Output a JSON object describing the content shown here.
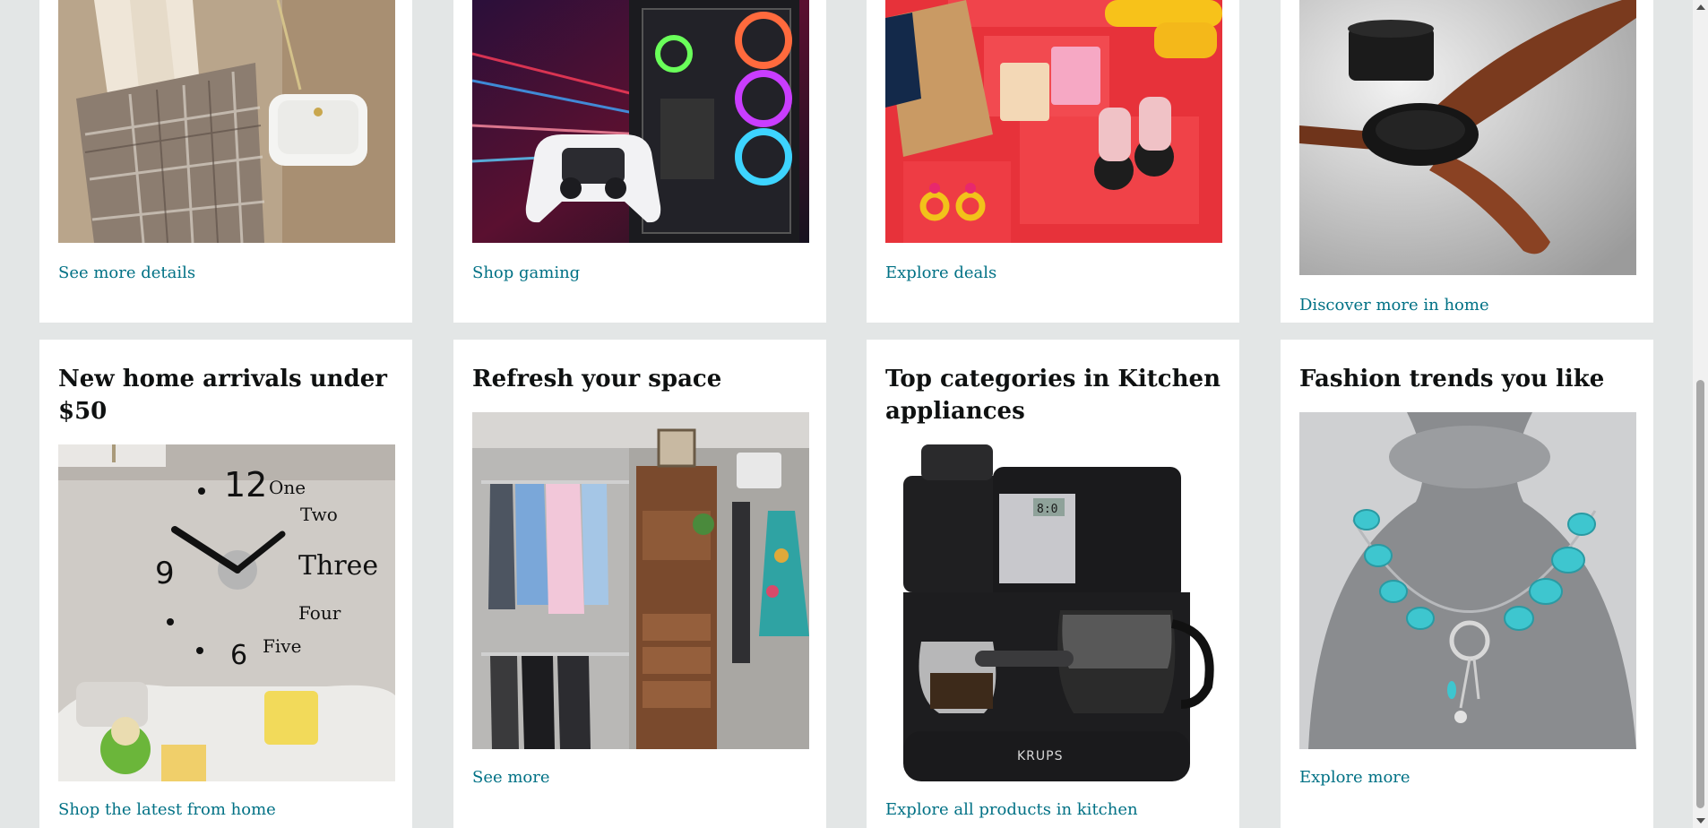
{
  "top_row": [
    {
      "link": "See more details",
      "image": "plaid skirt and white quilted handbag outfit"
    },
    {
      "link": "Shop gaming",
      "image": "gaming PC tower and white game controller"
    },
    {
      "link": "Explore deals",
      "image": "boxes, binoculars and earrings on red platforms"
    },
    {
      "link": "Discover more in home",
      "image": "wooden blade ceiling fan"
    }
  ],
  "bottom_row": [
    {
      "title": "New home arrivals under $50",
      "link": "Shop the latest from home",
      "image": "3D wall clock above sofa",
      "clock_text": {
        "twelve": "12",
        "one": "One",
        "two": "Two",
        "three": "Three",
        "four": "Four",
        "five": "Five",
        "six": "6",
        "nine": "9"
      }
    },
    {
      "title": "Refresh your space",
      "link": "See more",
      "image": "closet organizer with shirts and shelves"
    },
    {
      "title": "Top categories in Kitchen appliances",
      "link": "Explore all products in kitchen",
      "image": "KRUPS espresso and coffee maker",
      "brand": "KRUPS",
      "display": "8:0"
    },
    {
      "title": "Fashion trends you like",
      "link": "Explore more",
      "image": "turquoise necklace on gray bust"
    }
  ]
}
